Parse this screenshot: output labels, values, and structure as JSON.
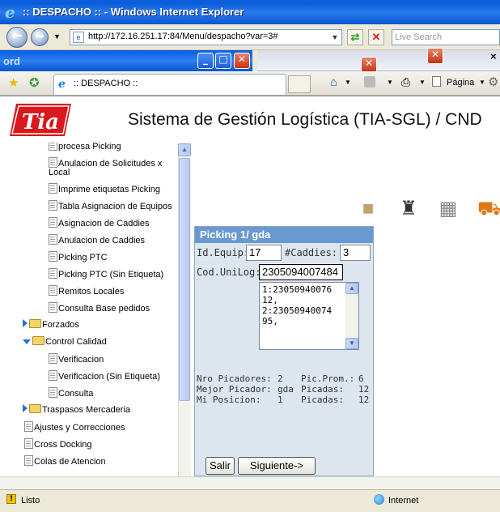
{
  "window": {
    "title": ":: DESPACHO :: - Windows Internet Explorer"
  },
  "toolbar": {
    "url": "http://172.16.251.17:84/Menu/despacho?var=3#",
    "search_placeholder": "Live Search"
  },
  "background_window": {
    "label": "ord"
  },
  "tab": {
    "title": ":: DESPACHO ::"
  },
  "commands": {
    "page_label": "Página"
  },
  "app": {
    "logo_text": "Tia",
    "title": "Sistema de Gestión Logística (TIA-SGL) / CND"
  },
  "tree": {
    "items": [
      {
        "label": "procesa Picking",
        "type": "doc"
      },
      {
        "label": "Anulacion de Solicitudes x",
        "type": "doc"
      },
      {
        "label": "Local",
        "type": "cont"
      },
      {
        "label": "Imprime etiquetas Picking",
        "type": "doc"
      },
      {
        "label": "Tabla Asignacion de Equipos",
        "type": "doc"
      },
      {
        "label": "Asignacion de Caddies",
        "type": "doc"
      },
      {
        "label": "Anulacion de Caddies",
        "type": "doc"
      },
      {
        "label": "Picking PTC",
        "type": "doc"
      },
      {
        "label": "Picking PTC (Sin Etiqueta)",
        "type": "doc"
      },
      {
        "label": "Remitos Locales",
        "type": "doc"
      },
      {
        "label": "Consulta Base pedidos",
        "type": "doc"
      },
      {
        "label": "Forzados",
        "type": "folder"
      },
      {
        "label": "Control Calidad",
        "type": "folder-open"
      },
      {
        "label": "Verificacion",
        "type": "doc"
      },
      {
        "label": "Verificacion (Sin Etiqueta)",
        "type": "doc"
      },
      {
        "label": "Consulta",
        "type": "doc"
      },
      {
        "label": "Traspasos Mercaderia",
        "type": "folder"
      },
      {
        "label": "Ajustes y Correcciones",
        "type": "doc"
      },
      {
        "label": "Cross Docking",
        "type": "doc"
      },
      {
        "label": "Colas de Atencion",
        "type": "doc"
      }
    ]
  },
  "picking": {
    "header": "Picking 1/ gda",
    "id_equip_label": "Id.Equip:",
    "id_equip_value": "17",
    "caddies_label": "#Caddies:",
    "caddies_value": "3",
    "cod_unilog_label": "Cod.UniLog:",
    "cod_unilog_value": "2305094007484",
    "list_text": "1:23050940076\n12,\n2:23050940074\n95,",
    "stats": {
      "nro_picadores_label": "Nro Picadores:",
      "nro_picadores_value": "2",
      "pic_prom_label": "Pic.Prom.:",
      "pic_prom_value": "6",
      "mejor_picador_label": "Mejor Picador:",
      "mejor_picador_value": "gda",
      "picadas_label_1": "Picadas:",
      "picadas_value_1": "12",
      "mi_posicion_label": "Mi Posicion:",
      "mi_posicion_value": "1",
      "picadas_label_2": "Picadas:",
      "picadas_value_2": "12"
    },
    "salir_label": "Salir",
    "siguiente_label": "Siguiente->"
  },
  "status": {
    "text": "Listo",
    "zone": "Internet"
  },
  "colors": {
    "titlebar": "#0a5ee0",
    "panel_header": "#6a98d0",
    "logo_red": "#d8181c"
  }
}
